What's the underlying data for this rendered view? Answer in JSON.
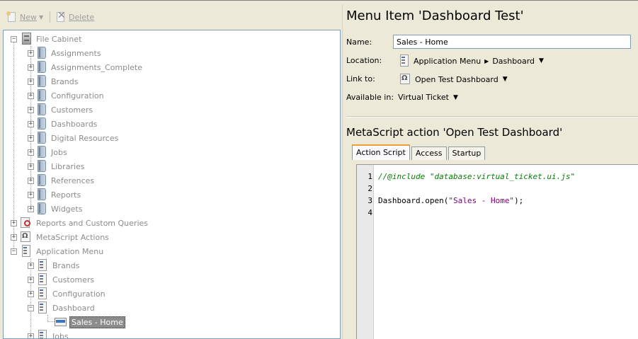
{
  "toolbar": {
    "new_label": "New",
    "delete_label": "Delete"
  },
  "tree": {
    "file_cabinet": {
      "label": "File Cabinet",
      "children": [
        "Assignments",
        "Assignments_Complete",
        "Brands",
        "Configuration",
        "Customers",
        "Dashboards",
        "Digital Resources",
        "Jobs",
        "Libraries",
        "References",
        "Reports",
        "Widgets"
      ]
    },
    "reports": {
      "label": "Reports and Custom Queries"
    },
    "metascript": {
      "label": "MetaScript Actions"
    },
    "app_menu": {
      "label": "Application Menu",
      "children": [
        "Brands",
        "Customers",
        "Configuration",
        "Dashboard"
      ],
      "dashboard_child": "Sales - Home",
      "after": "Jobs"
    }
  },
  "detail": {
    "title": "Menu Item 'Dashboard Test'",
    "name_label": "Name:",
    "name_value": "Sales - Home",
    "location_label": "Location:",
    "location_part1": "Application Menu",
    "location_part2": "Dashboard",
    "link_label": "Link to:",
    "link_value": "Open Test Dashboard",
    "available_label": "Available in:",
    "available_value": "Virtual Ticket",
    "action_title": "MetaScript action 'Open Test Dashboard'",
    "tabs": [
      "Action Script",
      "Access",
      "Startup"
    ],
    "code": {
      "line_numbers": [
        "1",
        "2",
        "3",
        "4"
      ],
      "line1": "//@include \"database:virtual_ticket.ui.js\"",
      "line3_pre": "Dashboard.open(",
      "line3_str": "\"Sales - Home\"",
      "line3_post": ");"
    }
  },
  "colors": {
    "accent_tab": "#f0a030",
    "selection": "#8c8c8c",
    "comment": "#008000",
    "string": "#800080"
  }
}
